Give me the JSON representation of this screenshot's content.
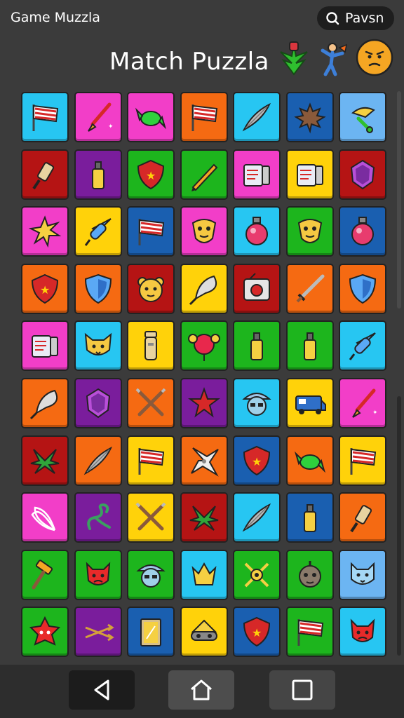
{
  "app": {
    "title": "Game Muzzla"
  },
  "search": {
    "label": "Pavsn",
    "icon": "search-icon"
  },
  "heading": {
    "title": "Match Puzzla",
    "icons": [
      "plant-icon",
      "jumping-person-icon",
      "smiley-face-icon"
    ]
  },
  "palette": {
    "cyan": "#27c6f2",
    "magenta": "#f23ec8",
    "orange": "#f56a12",
    "blue": "#1a5fb0",
    "green": "#1db51d",
    "red": "#b51414",
    "purple": "#7a1d9c",
    "yellow": "#ffd20a",
    "lightblue": "#6cb5f2"
  },
  "board": {
    "rows": [
      [
        {
          "bg": "cyan",
          "icon": "flag-icon"
        },
        {
          "bg": "magenta",
          "icon": "brush-icon"
        },
        {
          "bg": "magenta",
          "icon": "candy-icon"
        },
        {
          "bg": "orange",
          "icon": "flag-icon"
        },
        {
          "bg": "cyan",
          "icon": "leaf-blade-icon"
        },
        {
          "bg": "blue",
          "icon": "maple-leaf-icon"
        },
        {
          "bg": "lightblue",
          "icon": "bird-icon"
        }
      ],
      [
        {
          "bg": "red",
          "icon": "cannon-icon"
        },
        {
          "bg": "purple",
          "icon": "bottle-icon"
        },
        {
          "bg": "green",
          "icon": "shield-star-icon"
        },
        {
          "bg": "green",
          "icon": "pencil-icon"
        },
        {
          "bg": "magenta",
          "icon": "document-icon"
        },
        {
          "bg": "yellow",
          "icon": "document-icon"
        },
        {
          "bg": "red",
          "icon": "gem-shield-icon"
        }
      ],
      [
        {
          "bg": "magenta",
          "icon": "burst-icon"
        },
        {
          "bg": "yellow",
          "icon": "rocket-icon"
        },
        {
          "bg": "blue",
          "icon": "flag-icon"
        },
        {
          "bg": "magenta",
          "icon": "mask-icon"
        },
        {
          "bg": "cyan",
          "icon": "potion-icon"
        },
        {
          "bg": "green",
          "icon": "mask-icon"
        },
        {
          "bg": "blue",
          "icon": "potion-icon"
        }
      ],
      [
        {
          "bg": "orange",
          "icon": "shield-star-icon"
        },
        {
          "bg": "orange",
          "icon": "shield-icon"
        },
        {
          "bg": "red",
          "icon": "bear-icon"
        },
        {
          "bg": "yellow",
          "icon": "feather-icon"
        },
        {
          "bg": "red",
          "icon": "radio-icon"
        },
        {
          "bg": "orange",
          "icon": "sword-icon"
        },
        {
          "bg": "orange",
          "icon": "shield-icon"
        }
      ],
      [
        {
          "bg": "magenta",
          "icon": "document-icon"
        },
        {
          "bg": "cyan",
          "icon": "fox-icon"
        },
        {
          "bg": "yellow",
          "icon": "jar-icon"
        },
        {
          "bg": "green",
          "icon": "balloon-icon"
        },
        {
          "bg": "green",
          "icon": "bottle-icon"
        },
        {
          "bg": "green",
          "icon": "bottle-icon"
        },
        {
          "bg": "cyan",
          "icon": "rocket-icon"
        }
      ],
      [
        {
          "bg": "orange",
          "icon": "feather-icon"
        },
        {
          "bg": "purple",
          "icon": "gem-shield-icon"
        },
        {
          "bg": "orange",
          "icon": "crossed-swords-icon"
        },
        {
          "bg": "purple",
          "icon": "star-icon"
        },
        {
          "bg": "cyan",
          "icon": "explorer-face-icon"
        },
        {
          "bg": "yellow",
          "icon": "van-icon"
        },
        {
          "bg": "magenta",
          "icon": "brush-icon"
        }
      ],
      [
        {
          "bg": "red",
          "icon": "palm-leaf-icon"
        },
        {
          "bg": "orange",
          "icon": "leaf-blade-icon"
        },
        {
          "bg": "yellow",
          "icon": "flag-icon"
        },
        {
          "bg": "orange",
          "icon": "shuriken-icon"
        },
        {
          "bg": "blue",
          "icon": "shield-star-icon"
        },
        {
          "bg": "orange",
          "icon": "candy-icon"
        },
        {
          "bg": "yellow",
          "icon": "flag-icon"
        }
      ],
      [
        {
          "bg": "magenta",
          "icon": "whisk-icon"
        },
        {
          "bg": "purple",
          "icon": "dragon-icon"
        },
        {
          "bg": "yellow",
          "icon": "crossed-swords-icon"
        },
        {
          "bg": "red",
          "icon": "palm-leaf-icon"
        },
        {
          "bg": "cyan",
          "icon": "leaf-blade-icon"
        },
        {
          "bg": "blue",
          "icon": "bottle-icon"
        },
        {
          "bg": "orange",
          "icon": "cannon-icon"
        }
      ],
      [
        {
          "bg": "green",
          "icon": "hammer-icon"
        },
        {
          "bg": "green",
          "icon": "devil-face-icon"
        },
        {
          "bg": "green",
          "icon": "explorer-face-icon"
        },
        {
          "bg": "cyan",
          "icon": "crown-gem-icon"
        },
        {
          "bg": "green",
          "icon": "target-icon"
        },
        {
          "bg": "green",
          "icon": "alien-face-icon"
        },
        {
          "bg": "lightblue",
          "icon": "cat-face-icon"
        }
      ],
      [
        {
          "bg": "green",
          "icon": "star-monster-icon"
        },
        {
          "bg": "purple",
          "icon": "arrows-icon"
        },
        {
          "bg": "blue",
          "icon": "mirror-icon"
        },
        {
          "bg": "yellow",
          "icon": "hat-icon"
        },
        {
          "bg": "blue",
          "icon": "shield-star-icon"
        },
        {
          "bg": "green",
          "icon": "flag-icon"
        },
        {
          "bg": "cyan",
          "icon": "devil-face-icon"
        }
      ]
    ]
  },
  "navbar": {
    "buttons": [
      {
        "name": "back-button",
        "icon": "back-triangle-icon"
      },
      {
        "name": "home-button",
        "icon": "home-icon"
      },
      {
        "name": "recents-button",
        "icon": "square-icon"
      }
    ]
  }
}
